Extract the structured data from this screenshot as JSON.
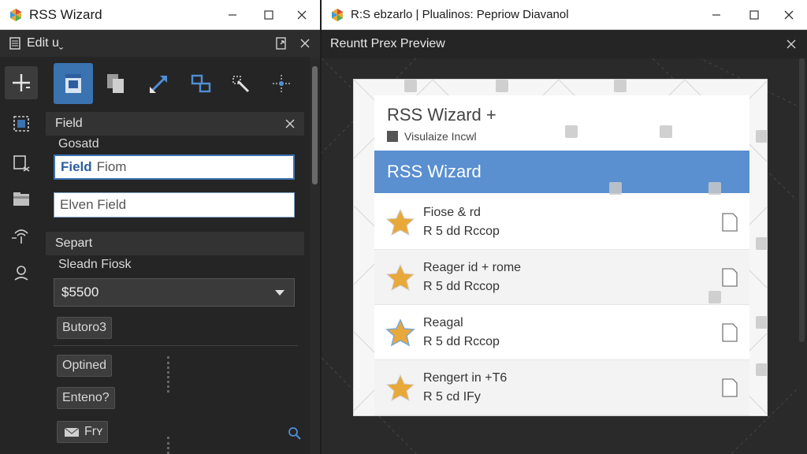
{
  "left_window": {
    "title": "RSS Wizard",
    "edit_panel_title": "Edit uˬ",
    "sections": {
      "field": {
        "header": "Field",
        "label": "Gosatd",
        "input1_strong": "Field",
        "input1_value": "Fiom",
        "input2_value": "Elven Field"
      },
      "separator": {
        "header": "Separt",
        "label": "Sleadn Fiosk",
        "select_value": "$5500",
        "button1": "Butoro3",
        "button2": "Optined",
        "button3": "Enteno?",
        "button4": "Frʏ"
      }
    },
    "rail_icons": [
      "plus-crosshair-icon",
      "image-frame-icon",
      "select-rect-icon",
      "folder-icon",
      "antenna-icon",
      "map-pin-icon"
    ],
    "toolbar_icons": [
      "save-page-icon",
      "copy-page-icon",
      "resize-diagonal-icon",
      "link-nodes-icon",
      "magic-wand-icon",
      "move-cross-icon"
    ]
  },
  "right_window": {
    "title": "R:S ebzarlo  |  Plualinos: Pepriow Diavanol",
    "panel_title": "Reuntt Prex Preview",
    "mock_app": {
      "title": "RSS Wizard +",
      "subtitle": "Visulaize Incwl",
      "banner": "RSS Wizard",
      "items": [
        {
          "line1": "Fiose & rd",
          "line2": "R 5 dd Rccop"
        },
        {
          "line1": "Reager id + rome",
          "line2": "R 5 dd Rccop"
        },
        {
          "line1": "Reagal",
          "line2": "R 5 dd Rccop"
        },
        {
          "line1": "Rengert in  +T6",
          "line2": "R 5 cd IFy"
        }
      ]
    }
  },
  "colors": {
    "accent": "#3b73b0",
    "banner": "#5a8fd0",
    "star": "#e8a93a",
    "dark_bg": "#252526"
  }
}
